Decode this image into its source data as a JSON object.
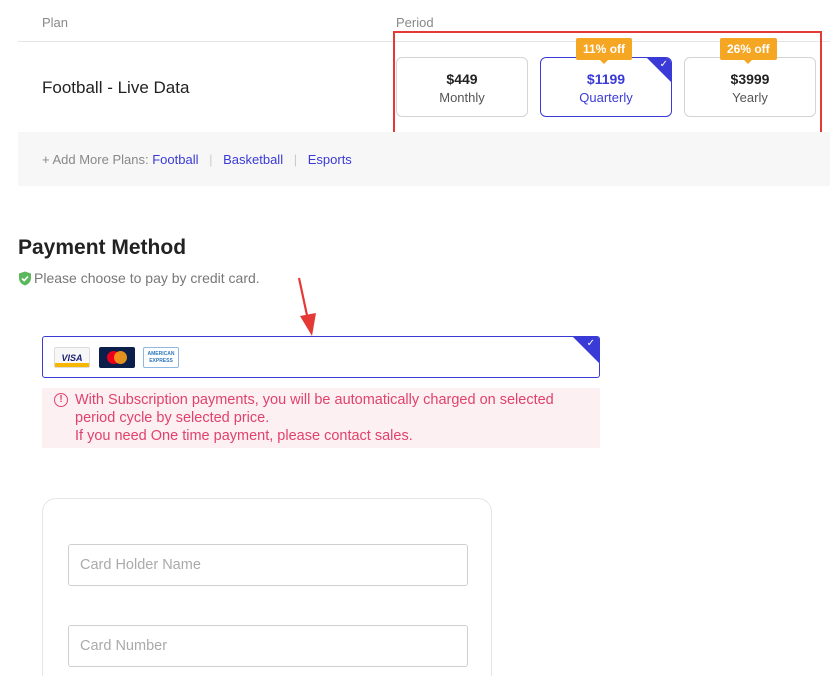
{
  "plan_table": {
    "col_plan": "Plan",
    "col_period": "Period",
    "plan_name": "Football - Live Data",
    "periods": [
      {
        "price": "$449",
        "term": "Monthly",
        "badge": "",
        "selected": false
      },
      {
        "price": "$1199",
        "term": "Quarterly",
        "badge": "11% off",
        "selected": true
      },
      {
        "price": "$3999",
        "term": "Yearly",
        "badge": "26% off",
        "selected": false
      }
    ]
  },
  "add_more": {
    "prefix": "+ Add More Plans:",
    "links": [
      "Football",
      "Basketball",
      "Esports"
    ]
  },
  "payment": {
    "title": "Payment Method",
    "subtitle": "Please choose to pay by credit card.",
    "card_brands": [
      "VISA",
      "MasterCard",
      "AMERICAN EXPRESS"
    ],
    "notice_line1": "With Subscription payments, you will be automatically charged on selected",
    "notice_line2": "period cycle by selected price.",
    "notice_line3": "If you need One time payment, please contact sales."
  },
  "form": {
    "holder_placeholder": "Card Holder Name",
    "number_placeholder": "Card Number"
  },
  "colors": {
    "accent": "#3a3ad6",
    "badge": "#f5a623",
    "highlight_box": "#e53935",
    "notice_text": "#e0426b",
    "notice_bg": "#fdf0f3",
    "shield": "#5cb85c"
  },
  "icons": [
    "check-icon",
    "shield-check-icon",
    "info-icon",
    "red-arrow-annotation"
  ]
}
